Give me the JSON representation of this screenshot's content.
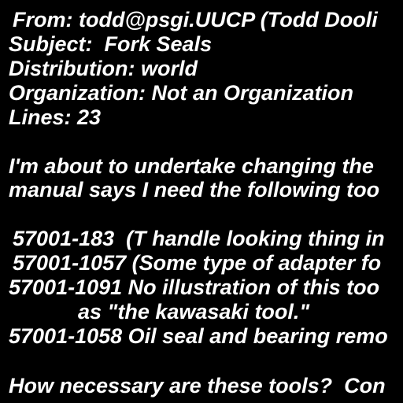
{
  "colors": {
    "background": "#000000",
    "text": "#ffffff"
  },
  "email": {
    "headers": {
      "from": "From: todd@psgi.UUCP (Todd Dooli",
      "subject": "Subject:  Fork Seals",
      "distribution": "Distribution: world",
      "organization": "Organization: Not an Organization",
      "lines": "Lines: 23"
    },
    "body": {
      "paragraph_1": [
        "I'm about to undertake changing the",
        "manual says I need the following too"
      ],
      "tools": [
        "57001-183  (T handle looking thing in",
        "57001-1057 (Some type of adapter fo",
        "57001-1091 No illustration of this too",
        "as \"the kawasaki tool.\"",
        "57001-1058 Oil seal and bearing remo"
      ],
      "question": "How necessary are these tools?  Con"
    }
  }
}
